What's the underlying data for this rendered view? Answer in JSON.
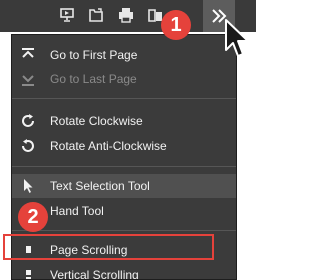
{
  "badges": {
    "first": "1",
    "second": "2"
  },
  "menu": {
    "go_first": "Go to First Page",
    "go_last": "Go to Last Page",
    "rotate_cw": "Rotate Clockwise",
    "rotate_ccw": "Rotate Anti-Clockwise",
    "text_selection": "Text Selection Tool",
    "hand_tool": "Hand Tool",
    "page_scrolling": "Page Scrolling",
    "vertical_scrolling": "Vertical Scrolling"
  },
  "colors": {
    "accent": "#e5423b",
    "menu_bg": "#3b3b3b",
    "toolbar_bg": "#3a3a3a"
  }
}
